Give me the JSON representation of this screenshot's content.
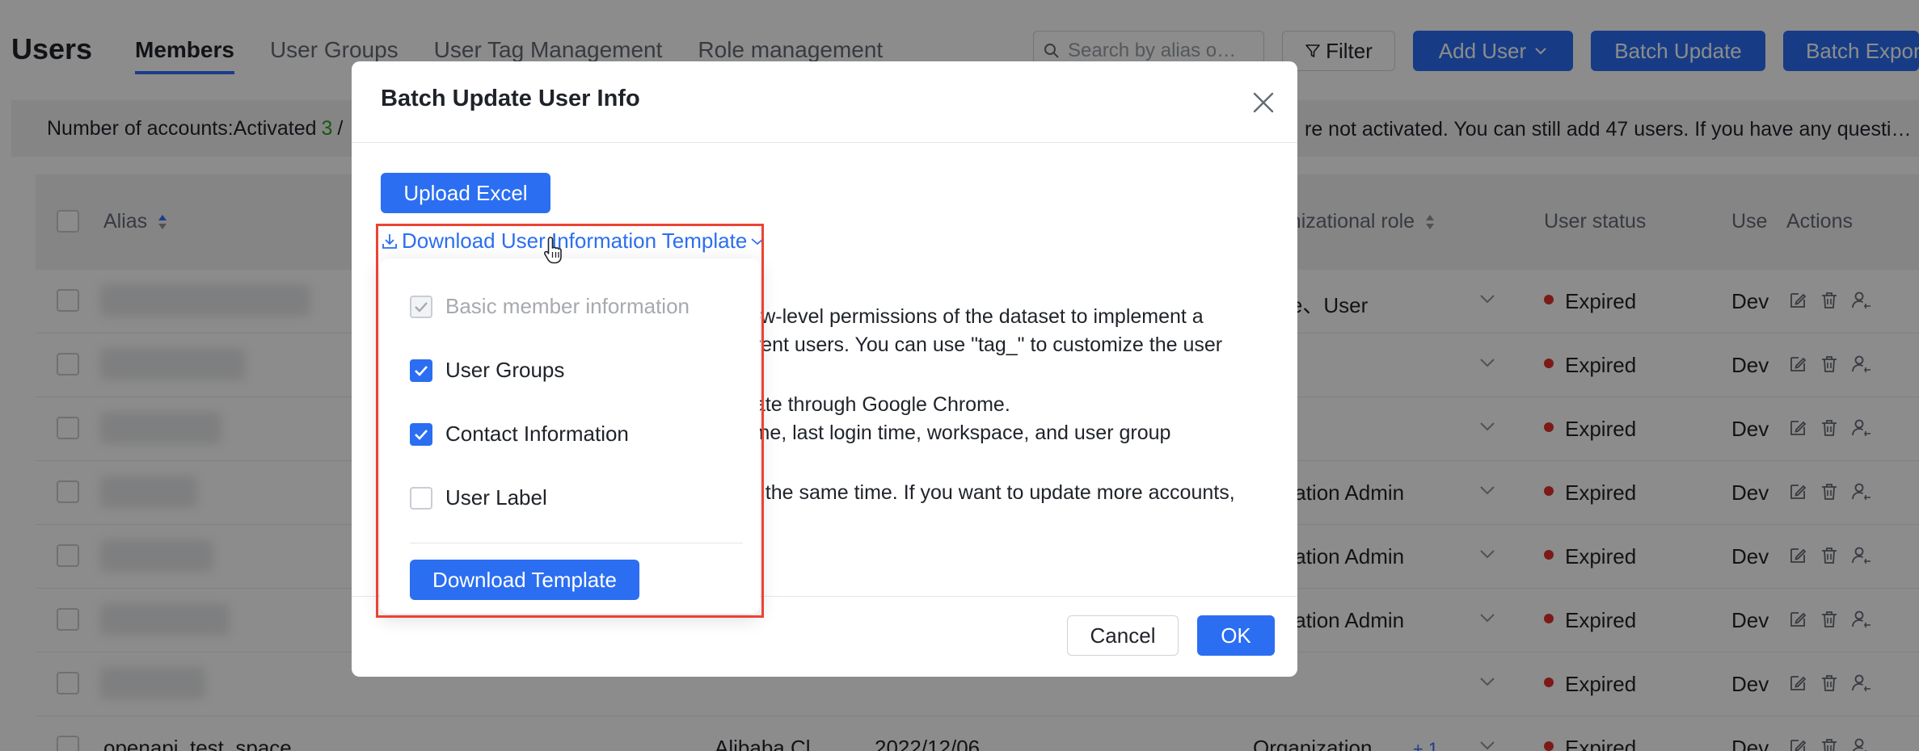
{
  "page": {
    "title": "Users",
    "tabs": [
      {
        "label": "Members",
        "active": true
      },
      {
        "label": "User Groups",
        "active": false
      },
      {
        "label": "User Tag Management",
        "active": false
      },
      {
        "label": "Role management",
        "active": false
      }
    ],
    "search_placeholder": "Search by alias o…",
    "filter_label": "Filter",
    "add_user_label": "Add User",
    "batch_update_label": "Batch Update",
    "batch_export_label": "Batch Expor",
    "notice": {
      "prefix": "Number of accounts:Activated",
      "activated_count": "3",
      "sep": "/",
      "tail": "re not activated. You can still add 47 users. If you have any questi…"
    },
    "table": {
      "headers": {
        "alias": "Alias",
        "org_role": "ganizational role",
        "user_status": "User status",
        "user_type": "Use",
        "actions": "Actions"
      },
      "rows": [
        {
          "org_role": "role、User",
          "status": "Expired",
          "type": "Dev"
        },
        {
          "org_role": "",
          "status": "Expired",
          "type": "Dev"
        },
        {
          "org_role": "",
          "status": "Expired",
          "type": "Dev"
        },
        {
          "org_role": "nization Admin",
          "status": "Expired",
          "type": "Dev"
        },
        {
          "org_role": "nization Admin",
          "status": "Expired",
          "type": "Dev"
        },
        {
          "org_role": "nization Admin",
          "status": "Expired",
          "type": "Dev"
        },
        {
          "org_role": "",
          "status": "Expired",
          "type": "Dev"
        },
        {
          "alias": "openapi_test_space",
          "source": "Alibaba Cl…",
          "date": "2022/12/06",
          "org_role": "Organization …",
          "more": "+ 1 …",
          "status": "Expired",
          "type": "Dev"
        }
      ]
    }
  },
  "modal": {
    "title": "Batch Update User Info",
    "upload_label": "Upload Excel",
    "download_link": "Download User Information Template",
    "body_lines": [
      "row-level permissions of the dataset to implement a",
      "erent users. You can use \"tag_\" to customize the user",
      "date through Google Chrome.",
      "time, last login time, workspace, and user group",
      "at the same time. If you want to update more accounts,"
    ],
    "cancel_label": "Cancel",
    "ok_label": "OK"
  },
  "dropdown": {
    "options": [
      {
        "label": "Basic member information",
        "state": "checked-disabled"
      },
      {
        "label": "User Groups",
        "state": "checked"
      },
      {
        "label": "Contact Information",
        "state": "checked"
      },
      {
        "label": "User Label",
        "state": "unchecked"
      }
    ],
    "button_label": "Download Template"
  },
  "colors": {
    "primary": "#2b6ef2",
    "highlight": "#ea4335",
    "expired_dot": "#e0312f",
    "activated": "#2ea121"
  }
}
